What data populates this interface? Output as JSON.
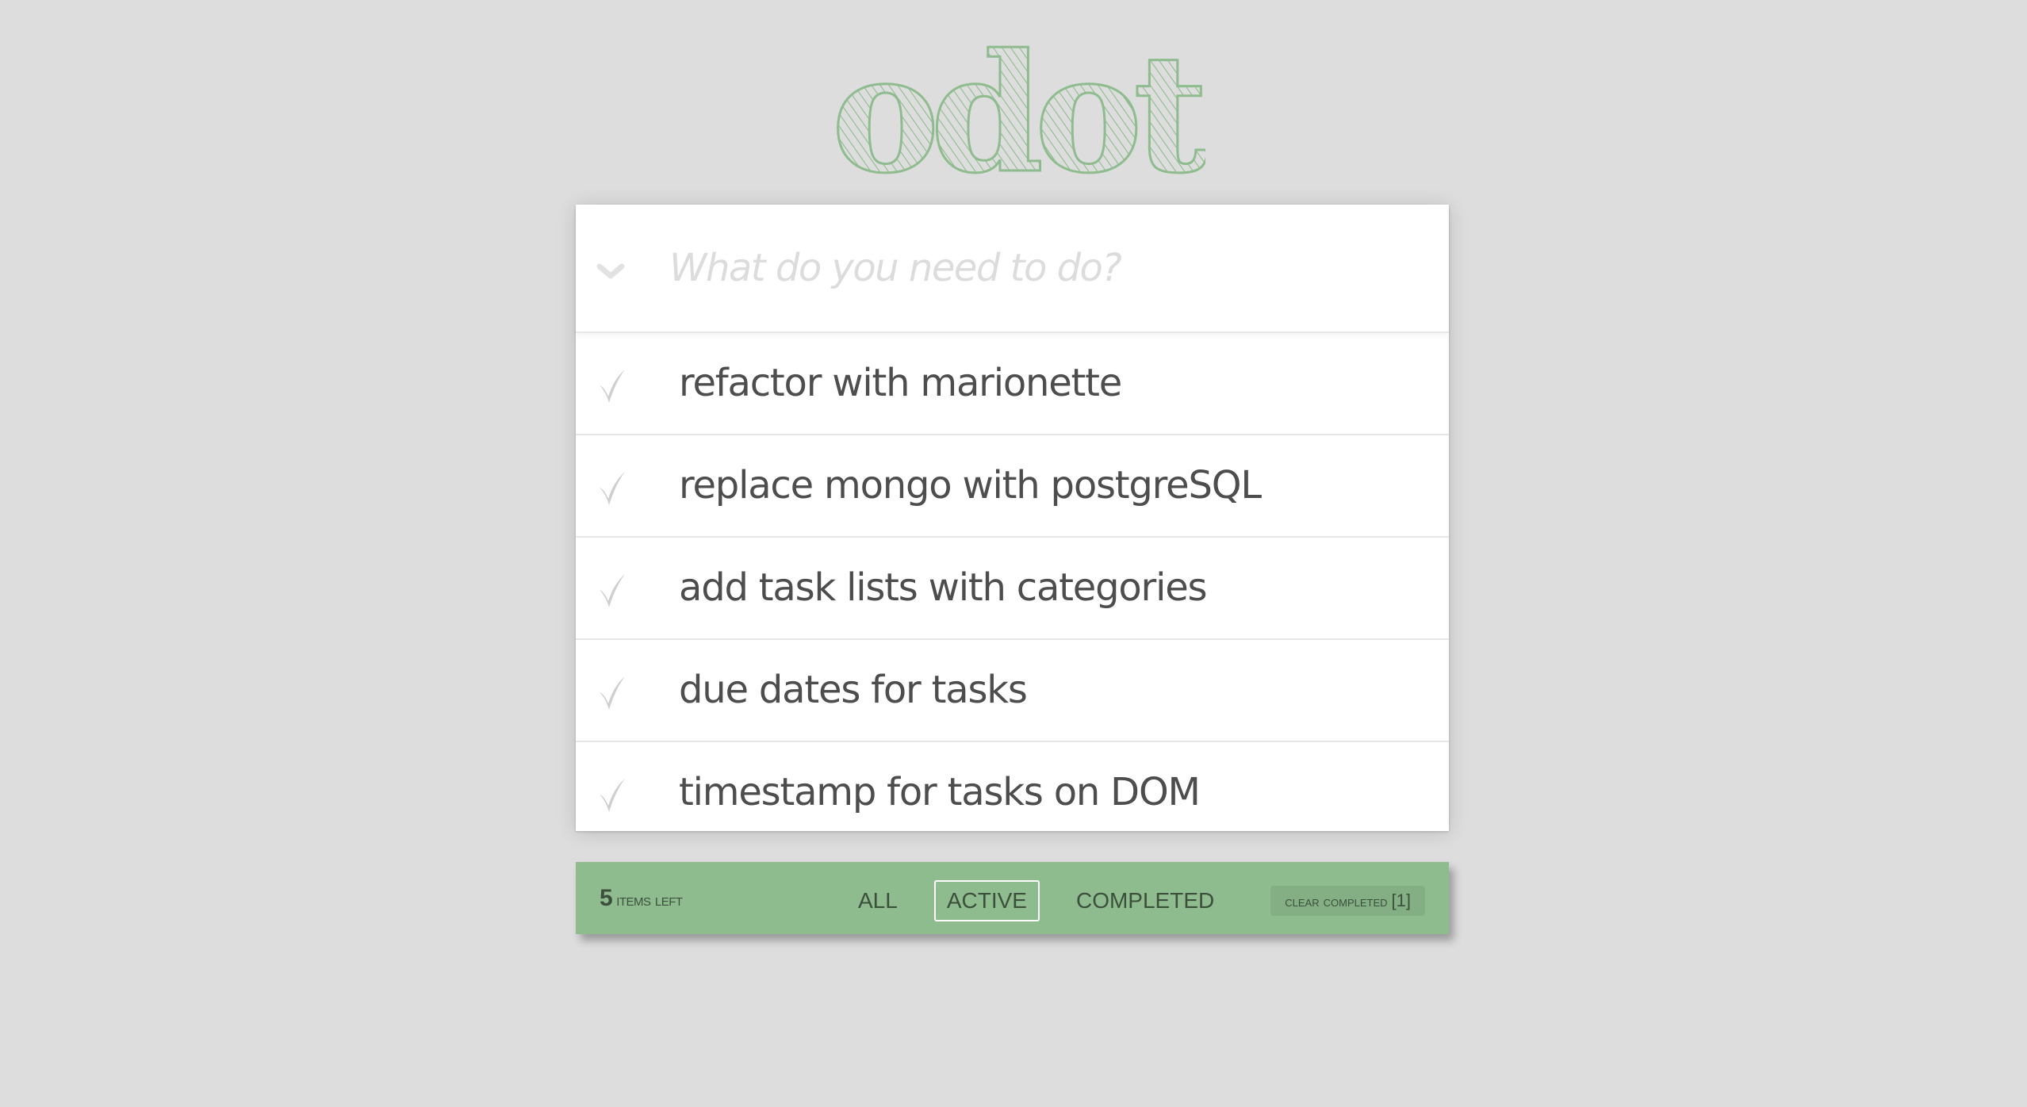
{
  "app": {
    "logo_text": "odot",
    "logo_color": "#8fbc8e"
  },
  "new_todo": {
    "placeholder": "What do you need to do?",
    "value": ""
  },
  "todos": [
    {
      "label": "refactor with marionette",
      "completed": false
    },
    {
      "label": "replace mongo with postgreSQL",
      "completed": false
    },
    {
      "label": "add task lists with categories",
      "completed": false
    },
    {
      "label": "due dates for tasks",
      "completed": false
    },
    {
      "label": "timestamp for tasks on DOM",
      "completed": false
    }
  ],
  "footer": {
    "count": "5",
    "count_label": "items left",
    "filters": [
      {
        "label": "ALL",
        "selected": false
      },
      {
        "label": "ACTIVE",
        "selected": true
      },
      {
        "label": "COMPLETED",
        "selected": false
      }
    ],
    "clear_label": "clear completed",
    "clear_count": "[1]",
    "background": "#8fbc8e"
  },
  "icons": {
    "toggle_all": "chevron-down-icon",
    "item_check": "checkmark-icon"
  }
}
